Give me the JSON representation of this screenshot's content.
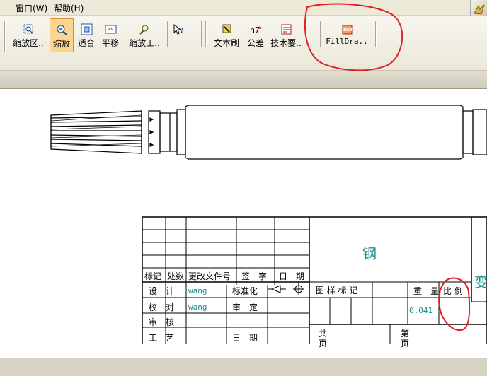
{
  "menu": {
    "window": "窗口(W)",
    "help": "帮助(H)"
  },
  "toolbar": {
    "zoom_window": "缩放区..",
    "zoom": "缩放",
    "fit": "适合",
    "pan": "平移",
    "zoom_tool": "缩放工..",
    "text_brush": "文本刷",
    "tolerance": "公差",
    "tech_req": "技术要..",
    "filldra": "FillDra.."
  },
  "title_block": {
    "material": "钢",
    "header_mark": "标记",
    "header_count": "处数",
    "header_change_doc": "更改文件号",
    "header_signature": "签　字",
    "header_date": "日　期",
    "design": "设　计",
    "designer": "wang",
    "standardize": "标准化",
    "check": "校　对",
    "checker": "wang",
    "approve_review": "审　定",
    "review": "审　核",
    "process": "工　艺",
    "date": "日　期",
    "pattern_mark": "图 样 标 记",
    "weight": "重　量",
    "scale": "比 例",
    "weight_value": "0.041",
    "total": "共",
    "sheet": "第",
    "page1": "页",
    "page2": "页",
    "right_char": "变"
  }
}
